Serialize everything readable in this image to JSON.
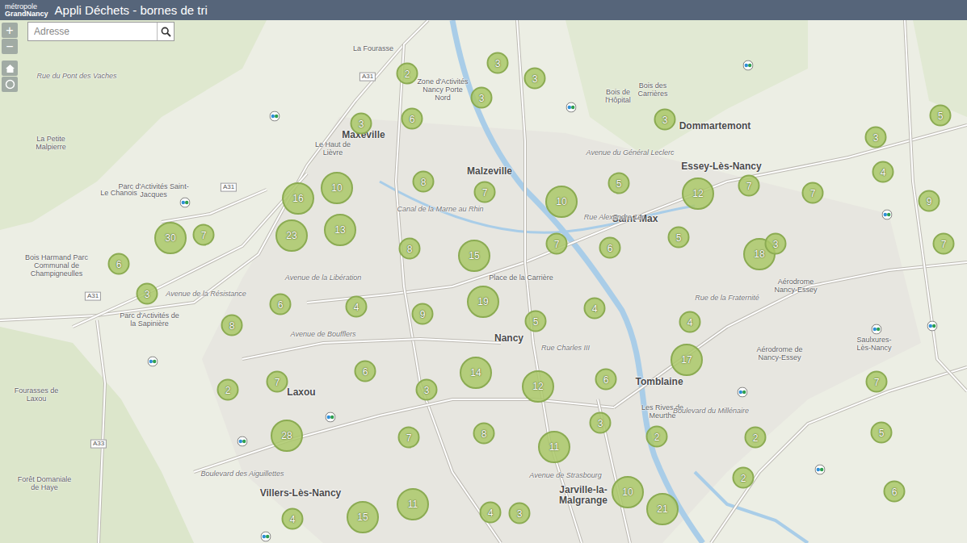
{
  "header": {
    "logo": [
      "métropole",
      "GrandNancy"
    ],
    "title": "Appli Déchets - bornes de tri"
  },
  "search": {
    "placeholder": "Adresse"
  },
  "zoom": [
    "+",
    "−"
  ],
  "labels": [
    {
      "text": "La Fourasse"
    },
    {
      "text": "Maxeville"
    },
    {
      "text": "Malzeville"
    },
    {
      "text": "Dommartemont"
    },
    {
      "text": "Essey-Lès-Nancy"
    },
    {
      "text": "Saint-Max"
    },
    {
      "text": "Nancy"
    },
    {
      "text": "Laxou"
    },
    {
      "text": "Tomblaine"
    },
    {
      "text": "Jarville-la-Malgrange"
    },
    {
      "text": "Villers-Lès-Nancy"
    },
    {
      "text": "Saulxures-Lès-Nancy"
    },
    {
      "text": "Le Chanois"
    },
    {
      "text": "La Petite Malpierre"
    },
    {
      "text": "Parc d'Activités Saint-Jacques"
    },
    {
      "text": "Le Haut de Lièvre"
    },
    {
      "text": "Bois Harmand Parc Communal de Champigneulles"
    },
    {
      "text": "Parc d'Activités de la Sapinière"
    },
    {
      "text": "Fourasses de Laxou"
    },
    {
      "text": "Forêt Domaniale de Haye"
    },
    {
      "text": "Place de la Carrière"
    },
    {
      "text": "Aérodrome Nancy-Essey"
    },
    {
      "text": "Aérodrome de Nancy-Essey"
    },
    {
      "text": "Zone d'Activités Nancy Porte Nord"
    },
    {
      "text": "Bois des Carrières"
    },
    {
      "text": "Bois de l'Hôpital"
    },
    {
      "text": "Les Rives de Meurthe"
    },
    {
      "text": "Avenue de la Libération"
    },
    {
      "text": "Avenue de Boufflers"
    },
    {
      "text": "Rue Charles III"
    },
    {
      "text": "Avenue de Strasbourg"
    },
    {
      "text": "Boulevard du Millénaire"
    },
    {
      "text": "Rue de la Fraternité"
    },
    {
      "text": "Rue Alexandre 1er"
    },
    {
      "text": "Canal de la Marne au Rhin"
    },
    {
      "text": "Avenue de la Résistance"
    },
    {
      "text": "Boulevard des Aiguillettes"
    },
    {
      "text": "Avenue du Général Leclerc"
    },
    {
      "text": "Rue du Pont des Vaches"
    },
    {
      "text": "A31"
    },
    {
      "text": "A31"
    },
    {
      "text": "A33"
    },
    {
      "text": "A31"
    }
  ],
  "clusters": [
    {
      "count": "2"
    },
    {
      "count": "3"
    },
    {
      "count": "3"
    },
    {
      "count": "3"
    },
    {
      "count": "6"
    },
    {
      "count": "3"
    },
    {
      "count": "3"
    },
    {
      "count": "5"
    },
    {
      "count": "3"
    },
    {
      "count": "4"
    },
    {
      "count": "8"
    },
    {
      "count": "7"
    },
    {
      "count": "16"
    },
    {
      "count": "10"
    },
    {
      "count": "10"
    },
    {
      "count": "5"
    },
    {
      "count": "12"
    },
    {
      "count": "7"
    },
    {
      "count": "7"
    },
    {
      "count": "9"
    },
    {
      "count": "30"
    },
    {
      "count": "7"
    },
    {
      "count": "23"
    },
    {
      "count": "13"
    },
    {
      "count": "8"
    },
    {
      "count": "15"
    },
    {
      "count": "7"
    },
    {
      "count": "6"
    },
    {
      "count": "5"
    },
    {
      "count": "18"
    },
    {
      "count": "3"
    },
    {
      "count": "7"
    },
    {
      "count": "6"
    },
    {
      "count": "3"
    },
    {
      "count": "6"
    },
    {
      "count": "4"
    },
    {
      "count": "9"
    },
    {
      "count": "19"
    },
    {
      "count": "5"
    },
    {
      "count": "4"
    },
    {
      "count": "4"
    },
    {
      "count": "8"
    },
    {
      "count": "17"
    },
    {
      "count": "14"
    },
    {
      "count": "6"
    },
    {
      "count": "12"
    },
    {
      "count": "6"
    },
    {
      "count": "7"
    },
    {
      "count": "2"
    },
    {
      "count": "3"
    },
    {
      "count": "7"
    },
    {
      "count": "3"
    },
    {
      "count": "8"
    },
    {
      "count": "7"
    },
    {
      "count": "28"
    },
    {
      "count": "11"
    },
    {
      "count": "2"
    },
    {
      "count": "2"
    },
    {
      "count": "5"
    },
    {
      "count": "2"
    },
    {
      "count": "10"
    },
    {
      "count": "6"
    },
    {
      "count": "11"
    },
    {
      "count": "15"
    },
    {
      "count": "4"
    },
    {
      "count": "4"
    },
    {
      "count": "3"
    },
    {
      "count": "21"
    }
  ]
}
